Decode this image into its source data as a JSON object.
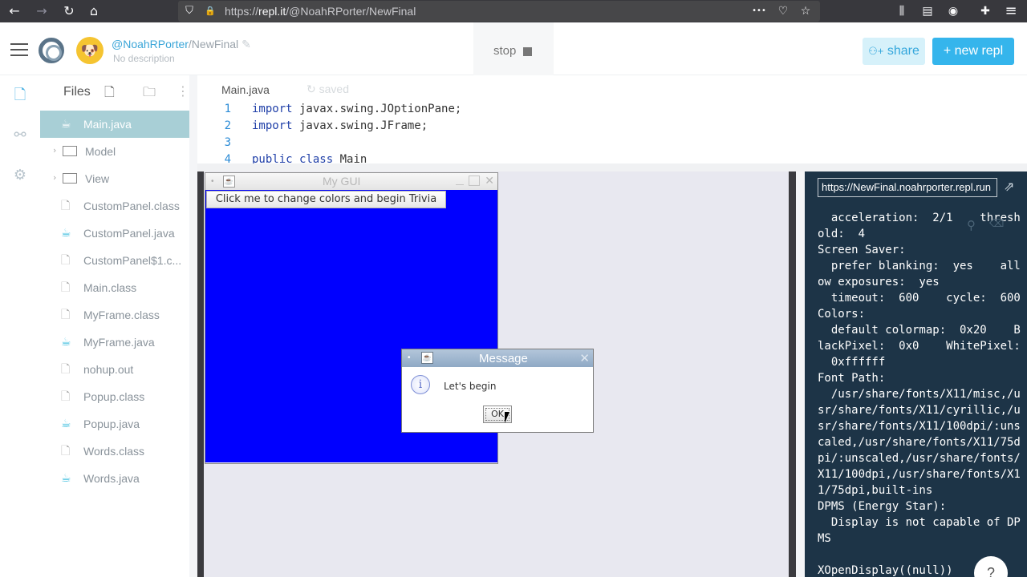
{
  "browser": {
    "url_prefix": "https://",
    "url_domain": "repl.it",
    "url_path": "/@NoahRPorter/NewFinal",
    "icons": {
      "back": "←",
      "forward": "→",
      "reload": "↻",
      "home": "⌂",
      "shield": "⛉",
      "lock": "🔒",
      "more": "•••",
      "pocket": "♡",
      "star": "☆",
      "library": "⫼",
      "sidebar": "▤",
      "account": "◉",
      "extensions": "✚",
      "menu": "≡"
    }
  },
  "header": {
    "owner": "@NoahRPorter",
    "repl_name": "/NewFinal",
    "description": "No description",
    "stop_label": "stop",
    "share_label": "share",
    "new_repl_label": "new repl",
    "share_icon": "⚇+",
    "new_repl_icon": "+",
    "edit_icon": "✎"
  },
  "files_panel": {
    "title": "Files",
    "add_file_icon": "🗋",
    "add_folder_icon": "🗀",
    "more_icon": "⋮",
    "items": [
      {
        "label": "Main.java",
        "type": "java",
        "active": true
      },
      {
        "label": "Model",
        "type": "folder"
      },
      {
        "label": "View",
        "type": "folder"
      },
      {
        "label": "CustomPanel.class",
        "type": "file"
      },
      {
        "label": "CustomPanel.java",
        "type": "java"
      },
      {
        "label": "CustomPanel$1.c...",
        "type": "file"
      },
      {
        "label": "Main.class",
        "type": "file"
      },
      {
        "label": "MyFrame.class",
        "type": "file"
      },
      {
        "label": "MyFrame.java",
        "type": "java"
      },
      {
        "label": "nohup.out",
        "type": "file"
      },
      {
        "label": "Popup.class",
        "type": "file"
      },
      {
        "label": "Popup.java",
        "type": "java"
      },
      {
        "label": "Words.class",
        "type": "file"
      },
      {
        "label": "Words.java",
        "type": "java"
      }
    ]
  },
  "editor": {
    "tab": "Main.java",
    "status": "saved",
    "status_icon": "↻",
    "lines": [
      {
        "n": "1",
        "kw": "import",
        "rest": " javax.swing.JOptionPane;"
      },
      {
        "n": "2",
        "kw": "import",
        "rest": " javax.swing.JFrame;"
      },
      {
        "n": "3",
        "kw": "",
        "rest": ""
      },
      {
        "n": "4",
        "kw": "public class",
        "rest": " Main"
      }
    ]
  },
  "gui_window": {
    "title": "My GUI",
    "button_label": "Click me to change colors and begin Trivia",
    "body_color": "#0000ff"
  },
  "dialog": {
    "title": "Message",
    "message": "Let's begin",
    "ok_label": "OK",
    "info_icon": "i"
  },
  "console": {
    "url": "https://NewFinal.noahrporter.repl.run",
    "output": "  acceleration:  2/1    thresh\nold:  4\nScreen Saver:\n  prefer blanking:  yes    all\now exposures:  yes\n  timeout:  600    cycle:  600\nColors:\n  default colormap:  0x20    B\nlackPixel:  0x0    WhitePixel:\n  0xffffff\nFont Path:\n  /usr/share/fonts/X11/misc,/u\nsr/share/fonts/X11/cyrillic,/u\nsr/share/fonts/X11/100dpi/:uns\ncaled,/usr/share/fonts/X11/75d\npi/:unscaled,/usr/share/fonts/\nX11/100dpi,/usr/share/fonts/X1\n1/75dpi,built-ins\nDPMS (Energy Star):\n  Display is not capable of DP\nMS\n\nXOpenDisplay((null))",
    "help_label": "?"
  },
  "colors": {
    "accent": "#35b5ec",
    "active_file": "#a8cfd6",
    "console_bg": "#1d3447"
  }
}
